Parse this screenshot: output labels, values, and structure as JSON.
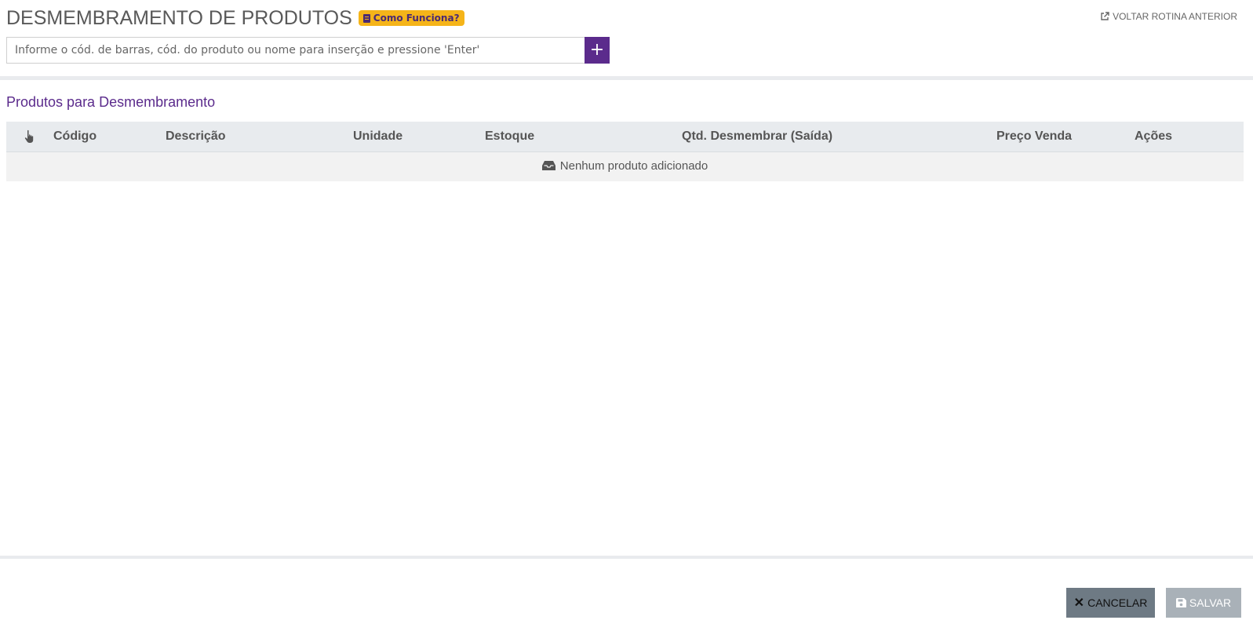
{
  "header": {
    "title": "DESMEMBRAMENTO DE PRODUTOS",
    "help_label": "Como Funciona?",
    "back_label": "VOLTAR ROTINA ANTERIOR"
  },
  "search": {
    "placeholder": "Informe o cód. de barras, cód. do produto ou nome para inserção e pressione 'Enter'",
    "add_label": "+"
  },
  "section": {
    "title": "Produtos para Desmembramento"
  },
  "table": {
    "columns": [
      "Código",
      "Descrição",
      "Unidade",
      "Estoque",
      "Qtd. Desmembrar (Saída)",
      "Preço Venda",
      "Ações"
    ],
    "empty_message": "Nenhum produto adicionado"
  },
  "footer": {
    "cancel_label": "CANCELAR",
    "save_label": "SALVAR"
  },
  "colors": {
    "primary": "#5b2b8c",
    "badge": "#f5b419",
    "cancel": "#6e7a84",
    "save_disabled": "#a9b1b8"
  },
  "icons": [
    "book-icon",
    "external-link-icon",
    "pointer-hand-icon",
    "inbox-icon",
    "close-icon",
    "floppy-disk-icon"
  ]
}
